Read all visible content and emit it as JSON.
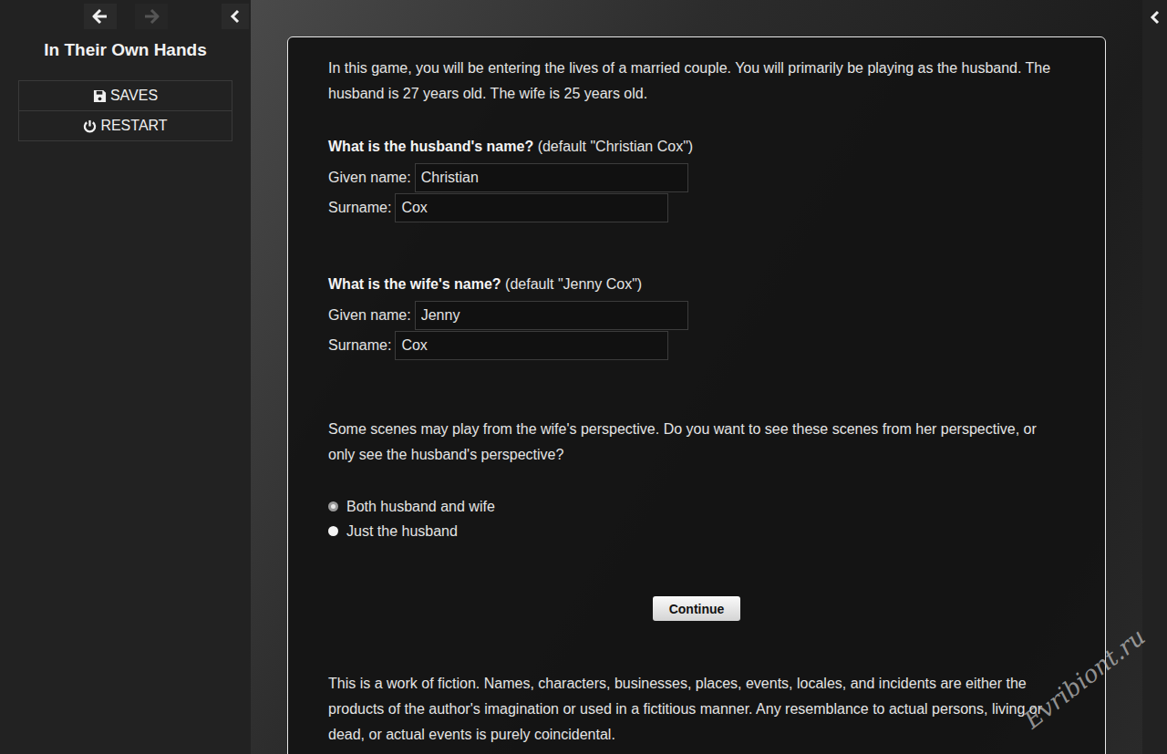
{
  "sidebar": {
    "title": "In Their Own Hands",
    "nav": [
      {
        "disabled": false
      },
      {
        "disabled": true
      }
    ],
    "menu": [
      {
        "label": "SAVES"
      },
      {
        "label": "RESTART"
      }
    ]
  },
  "passage": {
    "intro": "In this game, you will be entering the lives of a married couple. You will primarily be playing as the husband. The husband is 27 years old. The wife is 25 years old.",
    "questions": [
      {
        "question": "What is the husband's name?",
        "default": "(default \"Christian Cox\")",
        "fields": [
          {
            "label": "Given name:",
            "value": "Christian"
          },
          {
            "label": "Surname:",
            "value": "Cox"
          }
        ]
      },
      {
        "question": "What is the wife's name?",
        "default": "(default \"Jenny Cox\")",
        "fields": [
          {
            "label": "Given name:",
            "value": "Jenny"
          },
          {
            "label": "Surname:",
            "value": "Cox"
          }
        ]
      }
    ],
    "perspective": {
      "prompt": "Some scenes may play from the wife's perspective. Do you want to see these scenes from her perspective, or only see the husband's perspective?",
      "options": [
        {
          "label": "Both husband and wife",
          "selected": true
        },
        {
          "label": "Just the husband",
          "selected": false
        }
      ]
    },
    "button": "Continue",
    "disclaimer": "This is a work of fiction. Names, characters, businesses, places, events, locales, and incidents are either the products of the author's imagination or used in a fictitious manner. Any resemblance to actual persons, living or dead, or actual events is purely coincidental."
  },
  "watermark": "Evribiont.ru"
}
